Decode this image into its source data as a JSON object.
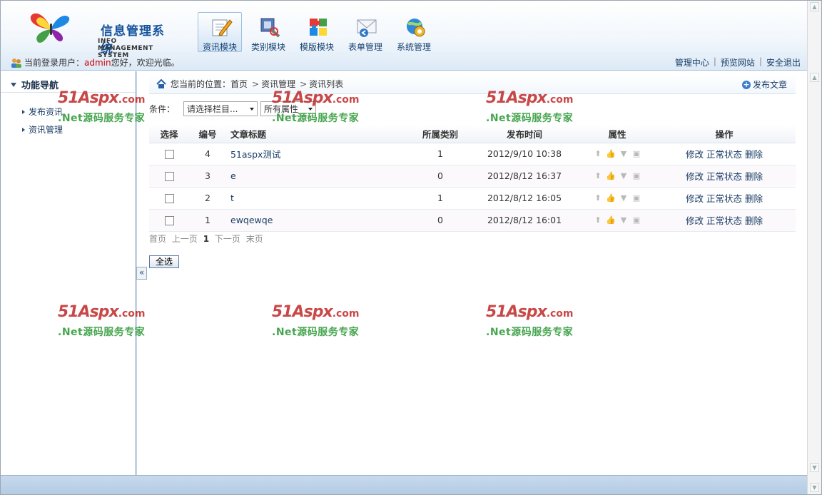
{
  "header": {
    "logo_title": "信息管理系统",
    "logo_subtitle": "INFO MANAGEMENT SYSTEM",
    "nav": [
      {
        "label": "资讯模块",
        "icon": "edit-document-icon",
        "active": true
      },
      {
        "label": "类别模块",
        "icon": "tools-icon",
        "active": false
      },
      {
        "label": "模版模块",
        "icon": "puzzle-icon",
        "active": false
      },
      {
        "label": "表单管理",
        "icon": "mail-form-icon",
        "active": false
      },
      {
        "label": "系统管理",
        "icon": "system-globe-icon",
        "active": false
      }
    ],
    "login_prefix": "当前登录用户：",
    "login_user": "admin",
    "login_suffix": "您好，欢迎光临。",
    "links": [
      "管理中心",
      "预览网站",
      "安全退出"
    ],
    "link_separator": "|"
  },
  "sidebar": {
    "title": "功能导航",
    "items": [
      {
        "label": "发布资讯"
      },
      {
        "label": "资讯管理"
      }
    ],
    "collapse_label": "«"
  },
  "main": {
    "breadcrumb": {
      "prefix": "您当前的位置：",
      "items": [
        "首页",
        "资讯管理",
        "资讯列表"
      ],
      "separator": ">"
    },
    "publish_label": "发布文章",
    "filter": {
      "label": "条件：",
      "category_select": "请选择栏目...",
      "attribute_select": "所有属性"
    },
    "table": {
      "headers": [
        "选择",
        "编号",
        "文章标题",
        "所属类别",
        "发布时间",
        "属性",
        "操作"
      ],
      "rows": [
        {
          "id": "4",
          "title": "51aspx测试",
          "category": "1",
          "time": "2012/9/10 10:38"
        },
        {
          "id": "3",
          "title": "e",
          "category": "0",
          "time": "2012/8/12 16:37"
        },
        {
          "id": "2",
          "title": "t",
          "category": "1",
          "time": "2012/8/12 16:05"
        },
        {
          "id": "1",
          "title": "ewqewqe",
          "category": "0",
          "time": "2012/8/12 16:01"
        }
      ],
      "actions": [
        "修改",
        "正常状态",
        "删除"
      ]
    },
    "pager": {
      "first": "首页",
      "prev": "上一页",
      "current": "1",
      "next": "下一页",
      "last": "末页"
    },
    "select_all_label": "全选"
  },
  "watermark": {
    "brand": "51Aspx",
    "domain": ".com",
    "slogan": ".Net源码服务专家"
  },
  "colors": {
    "accent": "#16539c",
    "username": "#cc0000",
    "watermark_red": "#be2828",
    "watermark_green": "#3ca046"
  }
}
